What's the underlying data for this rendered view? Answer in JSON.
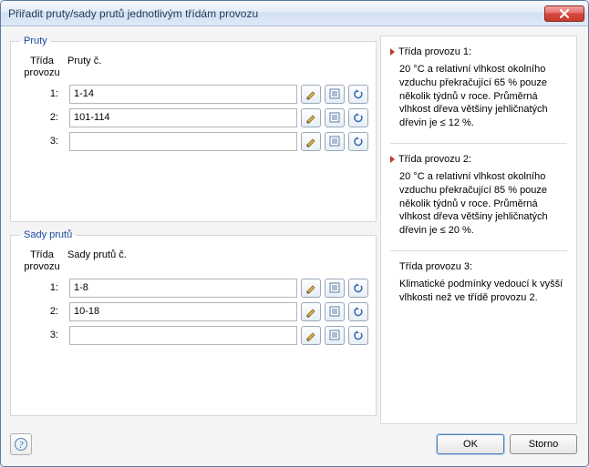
{
  "window": {
    "title": "Přiřadit pruty/sady prutů jednotlivým třídám provozu"
  },
  "groups": {
    "members": {
      "legend": "Pruty",
      "header_class": "Třída provozu",
      "header_list": "Pruty č.",
      "rows": [
        {
          "label": "1:",
          "value": "1-14"
        },
        {
          "label": "2:",
          "value": "101-114"
        },
        {
          "label": "3:",
          "value": ""
        }
      ]
    },
    "sets": {
      "legend": "Sady prutů",
      "header_class": "Třída provozu",
      "header_list": "Sady prutů č.",
      "rows": [
        {
          "label": "1:",
          "value": "1-8"
        },
        {
          "label": "2:",
          "value": "10-18"
        },
        {
          "label": "3:",
          "value": ""
        }
      ]
    }
  },
  "info": {
    "class1": {
      "title": "Třída provozu 1:",
      "text": "20 °C a relativní vlhkost okolního vzduchu překračující 65 % pouze několik týdnů v roce. Průměrná vlhkost dřeva většiny jehličnatých dřevin je ≤ 12 %."
    },
    "class2": {
      "title": "Třída provozu 2:",
      "text": "20 °C a relativní vlhkost okolního vzduchu překračující 85 % pouze několik týdnů v roce. Průměrná vlhkost dřeva většiny jehličnatých dřevin je ≤ 20 %."
    },
    "class3": {
      "title": "Třída provozu 3:",
      "text": "Klimatické podmínky vedoucí k vyšší vlhkosti než ve třídě provozu 2."
    }
  },
  "buttons": {
    "ok": "OK",
    "cancel": "Storno"
  }
}
